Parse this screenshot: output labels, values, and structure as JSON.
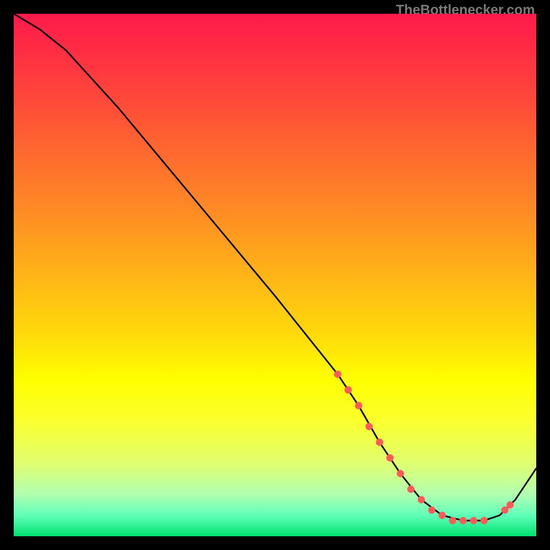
{
  "attribution": "TheBottlenecker.com",
  "chart_data": {
    "type": "line",
    "title": "",
    "xlabel": "",
    "ylabel": "",
    "xlim": [
      0,
      100
    ],
    "ylim": [
      0,
      100
    ],
    "background_gradient": {
      "stops": [
        {
          "pos": 0.0,
          "color": "#ff1a4b"
        },
        {
          "pos": 0.12,
          "color": "#ff3b3e"
        },
        {
          "pos": 0.25,
          "color": "#ff6431"
        },
        {
          "pos": 0.38,
          "color": "#ff8c24"
        },
        {
          "pos": 0.5,
          "color": "#ffb417"
        },
        {
          "pos": 0.62,
          "color": "#ffdc0a"
        },
        {
          "pos": 0.7,
          "color": "#ffff00"
        },
        {
          "pos": 0.78,
          "color": "#faff2e"
        },
        {
          "pos": 0.86,
          "color": "#e0ff70"
        },
        {
          "pos": 0.92,
          "color": "#b0ffb0"
        },
        {
          "pos": 0.96,
          "color": "#60ffb8"
        },
        {
          "pos": 1.0,
          "color": "#00e070"
        }
      ]
    },
    "series": [
      {
        "name": "bottleneck-curve",
        "x": [
          0,
          5,
          10,
          20,
          30,
          40,
          50,
          58,
          62,
          66,
          70,
          74,
          78,
          82,
          86,
          90,
          93,
          96,
          100
        ],
        "values": [
          100,
          97,
          93,
          82,
          70,
          58,
          46,
          36,
          31,
          25,
          18,
          12,
          7,
          4,
          3,
          3,
          4,
          7,
          13
        ]
      }
    ],
    "markers": {
      "name": "highlight-dots",
      "color": "#ff5a5a",
      "x": [
        62,
        64,
        66,
        68,
        70,
        72,
        74,
        76,
        78,
        80,
        82,
        84,
        86,
        88,
        90,
        94,
        95
      ],
      "values": [
        31,
        28,
        25,
        21,
        18,
        15,
        12,
        9,
        7,
        5,
        4,
        3,
        3,
        3,
        3,
        5,
        6
      ]
    }
  }
}
